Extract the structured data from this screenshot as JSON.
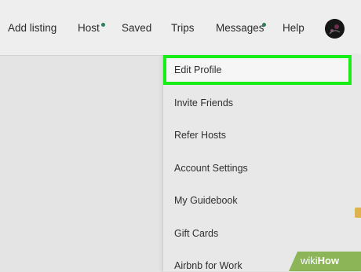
{
  "nav": {
    "add_listing": "Add listing",
    "host": "Host",
    "saved": "Saved",
    "trips": "Trips",
    "messages": "Messages",
    "help": "Help"
  },
  "menu": {
    "items": [
      "Edit Profile",
      "Invite Friends",
      "Refer Hosts",
      "Account Settings",
      "My Guidebook",
      "Gift Cards",
      "Airbnb for Work"
    ],
    "highlighted_item": "Edit Profile"
  },
  "watermark": {
    "prefix": "wiki",
    "suffix": "How"
  },
  "colors": {
    "highlight_border": "#16ee16",
    "notification_dot": "#2e7d5b",
    "watermark_bg": "#8bb557"
  }
}
